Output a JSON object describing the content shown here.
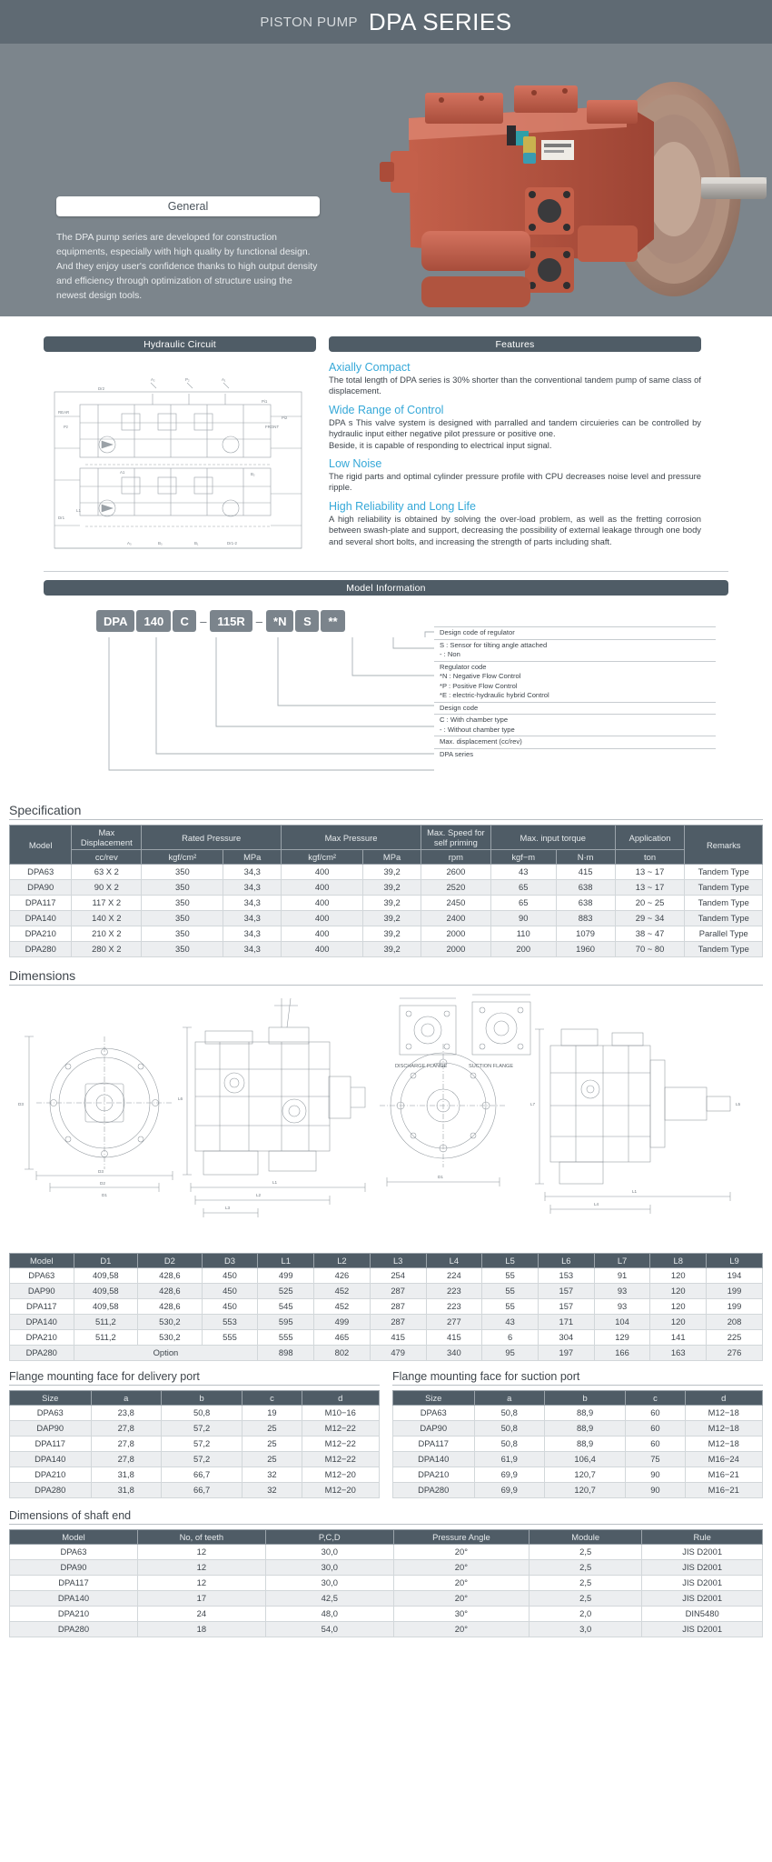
{
  "hero": {
    "kicker": "PISTON PUMP",
    "title": "DPA SERIES",
    "general_tab": "General",
    "general_text": "The DPA pump series are developed for construction equipments, especially with high quality by functional design.\nAnd they enjoy user's confidence thanks to high output density and efficiency through optimization of structure using the newest design tools."
  },
  "sections": {
    "hydraulic_circuit": "Hydraulic Circuit",
    "features": "Features",
    "model_information": "Model Information",
    "specification": "Specification",
    "dimensions": "Dimensions",
    "flange_delivery": "Flange mounting face for delivery port",
    "flange_suction": "Flange mounting face for suction port",
    "shaft_end": "Dimensions of shaft end"
  },
  "features": [
    {
      "heading": "Axially Compact",
      "body": "The total length of DPA series is 30% shorter than the conventional tandem pump of same class of displacement."
    },
    {
      "heading": "Wide Range of Control",
      "body": "DPA s This valve system is designed with parralled and tandem circuieries can be controlled by hydraulic input either negative pilot pressure or positive one.\nBeside, it is capable of responding to electrical input signal."
    },
    {
      "heading": "Low Noise",
      "body": "The rigid parts and optimal cylinder pressure profile with CPU decreases noise level and pressure ripple."
    },
    {
      "heading": "High Reliability and Long Life",
      "body": "A high reliability is obtained by solving the over-load problem, as well as the fretting corrosion between swash-plate and support, decreasing the possibility of external leakage through one body and several short bolts, and increasing the strength of parts including shaft."
    }
  ],
  "model_code": {
    "chips": [
      "DPA",
      "140",
      "C",
      "115R",
      "*N",
      "S",
      "**"
    ],
    "separator": "–",
    "legend": [
      [
        "Design code of regulator"
      ],
      [
        "S : Sensor for tilting angle attached",
        "- : Non"
      ],
      [
        "Regulator code",
        "*N : Negative Flow Control",
        "*P : Positive Flow Control",
        "*E : electric-hydraulic hybrid Control"
      ],
      [
        "Design code"
      ],
      [
        "C : With chamber type",
        "- : Without chamber type"
      ],
      [
        "Max. displacement (cc/rev)"
      ],
      [
        "DPA series"
      ]
    ]
  },
  "circuit_labels": {
    "ports": [
      "A2",
      "P2",
      "A1",
      "P1",
      "B2",
      "B1",
      "A3",
      "B3",
      "Dr2",
      "Dr1",
      "Pz",
      "Pi1",
      "Pi2",
      "REAR",
      "FRONT",
      "L1",
      "L2"
    ]
  },
  "spec_table": {
    "group_headers": [
      "Model",
      "Max Displacement",
      "Rated Pressure",
      "Max Pressure",
      "Max. Speed for self priming",
      "Max. input torque",
      "Application",
      "Remarks"
    ],
    "unit_headers": [
      "",
      "cc/rev",
      "kgf/cm²",
      "MPa",
      "kgf/cm²",
      "MPa",
      "rpm",
      "kgf−m",
      "N·m",
      "ton",
      ""
    ],
    "rows": [
      [
        "DPA63",
        "63 X 2",
        "350",
        "34,3",
        "400",
        "39,2",
        "2600",
        "43",
        "415",
        "13 ~ 17",
        "Tandem Type"
      ],
      [
        "DPA90",
        "90 X 2",
        "350",
        "34,3",
        "400",
        "39,2",
        "2520",
        "65",
        "638",
        "13 ~ 17",
        "Tandem Type"
      ],
      [
        "DPA117",
        "117 X 2",
        "350",
        "34,3",
        "400",
        "39,2",
        "2450",
        "65",
        "638",
        "20 ~ 25",
        "Tandem Type"
      ],
      [
        "DPA140",
        "140 X 2",
        "350",
        "34,3",
        "400",
        "39,2",
        "2400",
        "90",
        "883",
        "29 ~ 34",
        "Tandem Type"
      ],
      [
        "DPA210",
        "210 X 2",
        "350",
        "34,3",
        "400",
        "39,2",
        "2000",
        "110",
        "1079",
        "38 ~ 47",
        "Parallel Type"
      ],
      [
        "DPA280",
        "280 X 2",
        "350",
        "34,3",
        "400",
        "39,2",
        "2000",
        "200",
        "1960",
        "70 ~ 80",
        "Tandem Type"
      ]
    ]
  },
  "dim_table": {
    "headers": [
      "Model",
      "D1",
      "D2",
      "D3",
      "L1",
      "L2",
      "L3",
      "L4",
      "L5",
      "L6",
      "L7",
      "L8",
      "L9"
    ],
    "rows": [
      [
        "DPA63",
        "409,58",
        "428,6",
        "450",
        "499",
        "426",
        "254",
        "224",
        "55",
        "153",
        "91",
        "120",
        "194"
      ],
      [
        "DAP90",
        "409,58",
        "428,6",
        "450",
        "525",
        "452",
        "287",
        "223",
        "55",
        "157",
        "93",
        "120",
        "199"
      ],
      [
        "DPA117",
        "409,58",
        "428,6",
        "450",
        "545",
        "452",
        "287",
        "223",
        "55",
        "157",
        "93",
        "120",
        "199"
      ],
      [
        "DPA140",
        "511,2",
        "530,2",
        "553",
        "595",
        "499",
        "287",
        "277",
        "43",
        "171",
        "104",
        "120",
        "208"
      ],
      [
        "DPA210",
        "511,2",
        "530,2",
        "555",
        "555",
        "465",
        "415",
        "415",
        "6",
        "304",
        "129",
        "141",
        "225"
      ]
    ],
    "last_row": {
      "model": "DPA280",
      "option_label": "Option",
      "values": [
        "898",
        "802",
        "479",
        "340",
        "95",
        "197",
        "166",
        "163",
        "276"
      ]
    }
  },
  "flange_delivery_table": {
    "headers": [
      "Size",
      "a",
      "b",
      "c",
      "d"
    ],
    "rows": [
      [
        "DPA63",
        "23,8",
        "50,8",
        "19",
        "M10−16"
      ],
      [
        "DAP90",
        "27,8",
        "57,2",
        "25",
        "M12−22"
      ],
      [
        "DPA117",
        "27,8",
        "57,2",
        "25",
        "M12−22"
      ],
      [
        "DPA140",
        "27,8",
        "57,2",
        "25",
        "M12−22"
      ],
      [
        "DPA210",
        "31,8",
        "66,7",
        "32",
        "M12−20"
      ],
      [
        "DPA280",
        "31,8",
        "66,7",
        "32",
        "M12−20"
      ]
    ]
  },
  "flange_suction_table": {
    "headers": [
      "Size",
      "a",
      "b",
      "c",
      "d"
    ],
    "rows": [
      [
        "DPA63",
        "50,8",
        "88,9",
        "60",
        "M12−18"
      ],
      [
        "DAP90",
        "50,8",
        "88,9",
        "60",
        "M12−18"
      ],
      [
        "DPA117",
        "50,8",
        "88,9",
        "60",
        "M12−18"
      ],
      [
        "DPA140",
        "61,9",
        "106,4",
        "75",
        "M16−24"
      ],
      [
        "DPA210",
        "69,9",
        "120,7",
        "90",
        "M16−21"
      ],
      [
        "DPA280",
        "69,9",
        "120,7",
        "90",
        "M16−21"
      ]
    ]
  },
  "shaft_table": {
    "headers": [
      "Model",
      "No, of teeth",
      "P,C,D",
      "Pressure Angle",
      "Module",
      "Rule"
    ],
    "rows": [
      [
        "DPA63",
        "12",
        "30,0",
        "20°",
        "2,5",
        "JIS D2001"
      ],
      [
        "DPA90",
        "12",
        "30,0",
        "20°",
        "2,5",
        "JIS D2001"
      ],
      [
        "DPA117",
        "12",
        "30,0",
        "20°",
        "2,5",
        "JIS D2001"
      ],
      [
        "DPA140",
        "17",
        "42,5",
        "20°",
        "2,5",
        "JIS D2001"
      ],
      [
        "DPA210",
        "24",
        "48,0",
        "30°",
        "2,0",
        "DIN5480"
      ],
      [
        "DPA280",
        "18",
        "54,0",
        "20°",
        "3,0",
        "JIS D2001"
      ]
    ]
  },
  "drawing_labels": {
    "discharge_flange": "DISCHARGE FLANGE",
    "suction_flange": "SUCTION FLANGE"
  },
  "colors": {
    "bar": "#4f5c66",
    "hero": "#7c858c",
    "hero_bar": "#5f6a73",
    "accent": "#35a8d8",
    "chip": "#7b848c"
  }
}
